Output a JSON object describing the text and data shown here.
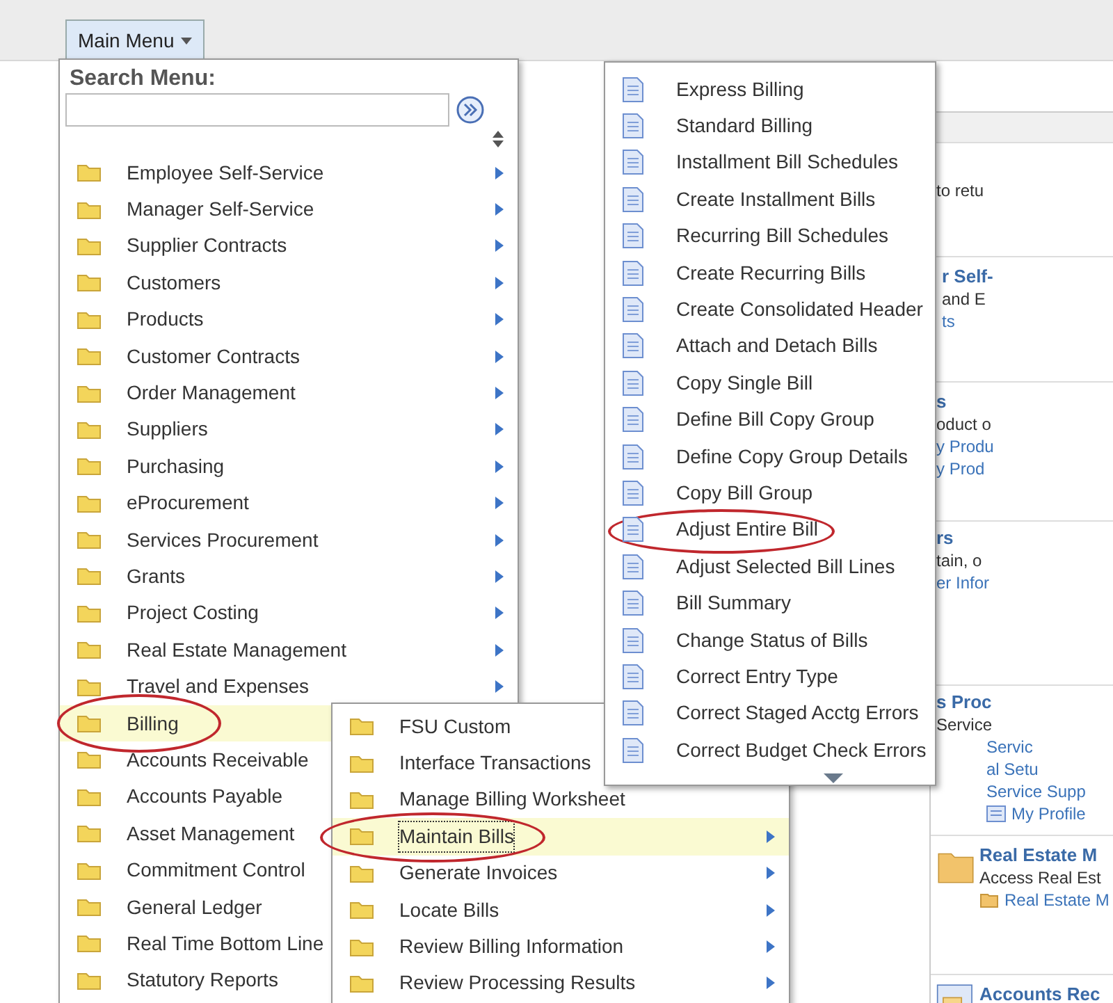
{
  "top_bar": {
    "menu_button": "Main Menu"
  },
  "main_menu": {
    "search_title": "Search Menu:",
    "items": [
      {
        "label": "Employee Self-Service",
        "arrow": true,
        "selected": false,
        "circled": false
      },
      {
        "label": "Manager Self-Service",
        "arrow": true,
        "selected": false,
        "circled": false
      },
      {
        "label": "Supplier Contracts",
        "arrow": true,
        "selected": false,
        "circled": false
      },
      {
        "label": "Customers",
        "arrow": true,
        "selected": false,
        "circled": false
      },
      {
        "label": "Products",
        "arrow": true,
        "selected": false,
        "circled": false
      },
      {
        "label": "Customer Contracts",
        "arrow": true,
        "selected": false,
        "circled": false
      },
      {
        "label": "Order Management",
        "arrow": true,
        "selected": false,
        "circled": false
      },
      {
        "label": "Suppliers",
        "arrow": true,
        "selected": false,
        "circled": false
      },
      {
        "label": "Purchasing",
        "arrow": true,
        "selected": false,
        "circled": false
      },
      {
        "label": "eProcurement",
        "arrow": true,
        "selected": false,
        "circled": false
      },
      {
        "label": "Services Procurement",
        "arrow": true,
        "selected": false,
        "circled": false
      },
      {
        "label": "Grants",
        "arrow": true,
        "selected": false,
        "circled": false
      },
      {
        "label": "Project Costing",
        "arrow": true,
        "selected": false,
        "circled": false
      },
      {
        "label": "Real Estate Management",
        "arrow": true,
        "selected": false,
        "circled": false
      },
      {
        "label": "Travel and Expenses",
        "arrow": true,
        "selected": false,
        "circled": false
      },
      {
        "label": "Billing",
        "selected": true,
        "circled": true
      },
      {
        "label": "Accounts Receivable",
        "selected": false,
        "circled": false
      },
      {
        "label": "Accounts Payable",
        "selected": false,
        "circled": false
      },
      {
        "label": "Asset Management",
        "selected": false,
        "circled": false
      },
      {
        "label": "Commitment Control",
        "selected": false,
        "circled": false
      },
      {
        "label": "General Ledger",
        "selected": false,
        "circled": false
      },
      {
        "label": "Real Time Bottom Line",
        "selected": false,
        "circled": false
      },
      {
        "label": "Statutory Reports",
        "selected": false,
        "circled": false
      }
    ]
  },
  "billing_menu": {
    "items": [
      {
        "label": "FSU Custom",
        "selected": false,
        "circled": false
      },
      {
        "label": "Interface Transactions",
        "selected": false,
        "circled": false
      },
      {
        "label": "Manage Billing Worksheet",
        "selected": false,
        "circled": false
      },
      {
        "label": "Maintain Bills",
        "arrow": true,
        "selected": true,
        "circled": true
      },
      {
        "label": "Generate Invoices",
        "arrow": true,
        "selected": false,
        "circled": false
      },
      {
        "label": "Locate Bills",
        "arrow": true,
        "selected": false,
        "circled": false
      },
      {
        "label": "Review Billing Information",
        "arrow": true,
        "selected": false,
        "circled": false
      },
      {
        "label": "Review Processing Results",
        "arrow": true,
        "selected": false,
        "circled": false
      }
    ]
  },
  "maintain_bills_menu": {
    "more_below": true,
    "items": [
      {
        "label": "Express Billing",
        "circled": false
      },
      {
        "label": "Standard Billing",
        "circled": false
      },
      {
        "label": "Installment Bill Schedules",
        "circled": false
      },
      {
        "label": "Create Installment Bills",
        "circled": false
      },
      {
        "label": "Recurring Bill Schedules",
        "circled": false
      },
      {
        "label": "Create Recurring Bills",
        "circled": false
      },
      {
        "label": "Create Consolidated Header",
        "circled": false
      },
      {
        "label": "Attach and Detach Bills",
        "circled": false
      },
      {
        "label": "Copy Single Bill",
        "circled": false
      },
      {
        "label": "Define Bill Copy Group",
        "circled": false
      },
      {
        "label": "Define Copy Group Details",
        "circled": false
      },
      {
        "label": "Copy Bill Group",
        "circled": false
      },
      {
        "label": "Adjust Entire Bill",
        "circled": true
      },
      {
        "label": "Adjust Selected Bill Lines",
        "circled": false
      },
      {
        "label": "Bill Summary",
        "circled": false
      },
      {
        "label": "Change Status of Bills",
        "circled": false
      },
      {
        "label": "Correct Entry Type",
        "circled": false
      },
      {
        "label": "Correct Staged Acctg Errors",
        "circled": false
      },
      {
        "label": "Correct Budget Check Errors",
        "circled": false
      }
    ]
  },
  "background_panel": {
    "sections": [
      {
        "kind": "plain",
        "lines": [
          {
            "kind": "text",
            "text": "to retu"
          }
        ]
      },
      {
        "kind": "plain",
        "lines": [
          {
            "kind": "heading",
            "text": "r Self-"
          },
          {
            "kind": "text",
            "text": "and E"
          },
          {
            "kind": "link",
            "text": "ts"
          }
        ]
      },
      {
        "kind": "plain",
        "lines": [
          {
            "kind": "heading",
            "text": "s"
          },
          {
            "kind": "text",
            "text": "oduct o"
          },
          {
            "kind": "link",
            "text": "y Produ"
          },
          {
            "kind": "link",
            "text": "y Prod"
          }
        ]
      },
      {
        "kind": "plain",
        "lines": [
          {
            "kind": "heading",
            "text": "rs"
          },
          {
            "kind": "text",
            "text": "tain, o"
          },
          {
            "kind": "link",
            "text": "er Infor"
          }
        ]
      },
      {
        "kind": "plain",
        "lines": [
          {
            "kind": "heading",
            "text": "s Proc"
          },
          {
            "kind": "text",
            "text": "Service"
          },
          {
            "kind": "link",
            "text": "Servic"
          },
          {
            "kind": "link",
            "text": "al Setu"
          },
          {
            "kind": "link",
            "text": "Service Supp"
          },
          {
            "kind": "profile_link",
            "text": "My Profile"
          }
        ]
      },
      {
        "kind": "folder",
        "lines": [
          {
            "kind": "heading",
            "text": "Real Estate M"
          },
          {
            "kind": "text",
            "text": "Access Real Est"
          },
          {
            "kind": "folder_link",
            "text": "Real Estate M"
          }
        ]
      },
      {
        "kind": "document",
        "lines": [
          {
            "kind": "heading",
            "text": "Accounts Rec"
          }
        ]
      }
    ]
  }
}
